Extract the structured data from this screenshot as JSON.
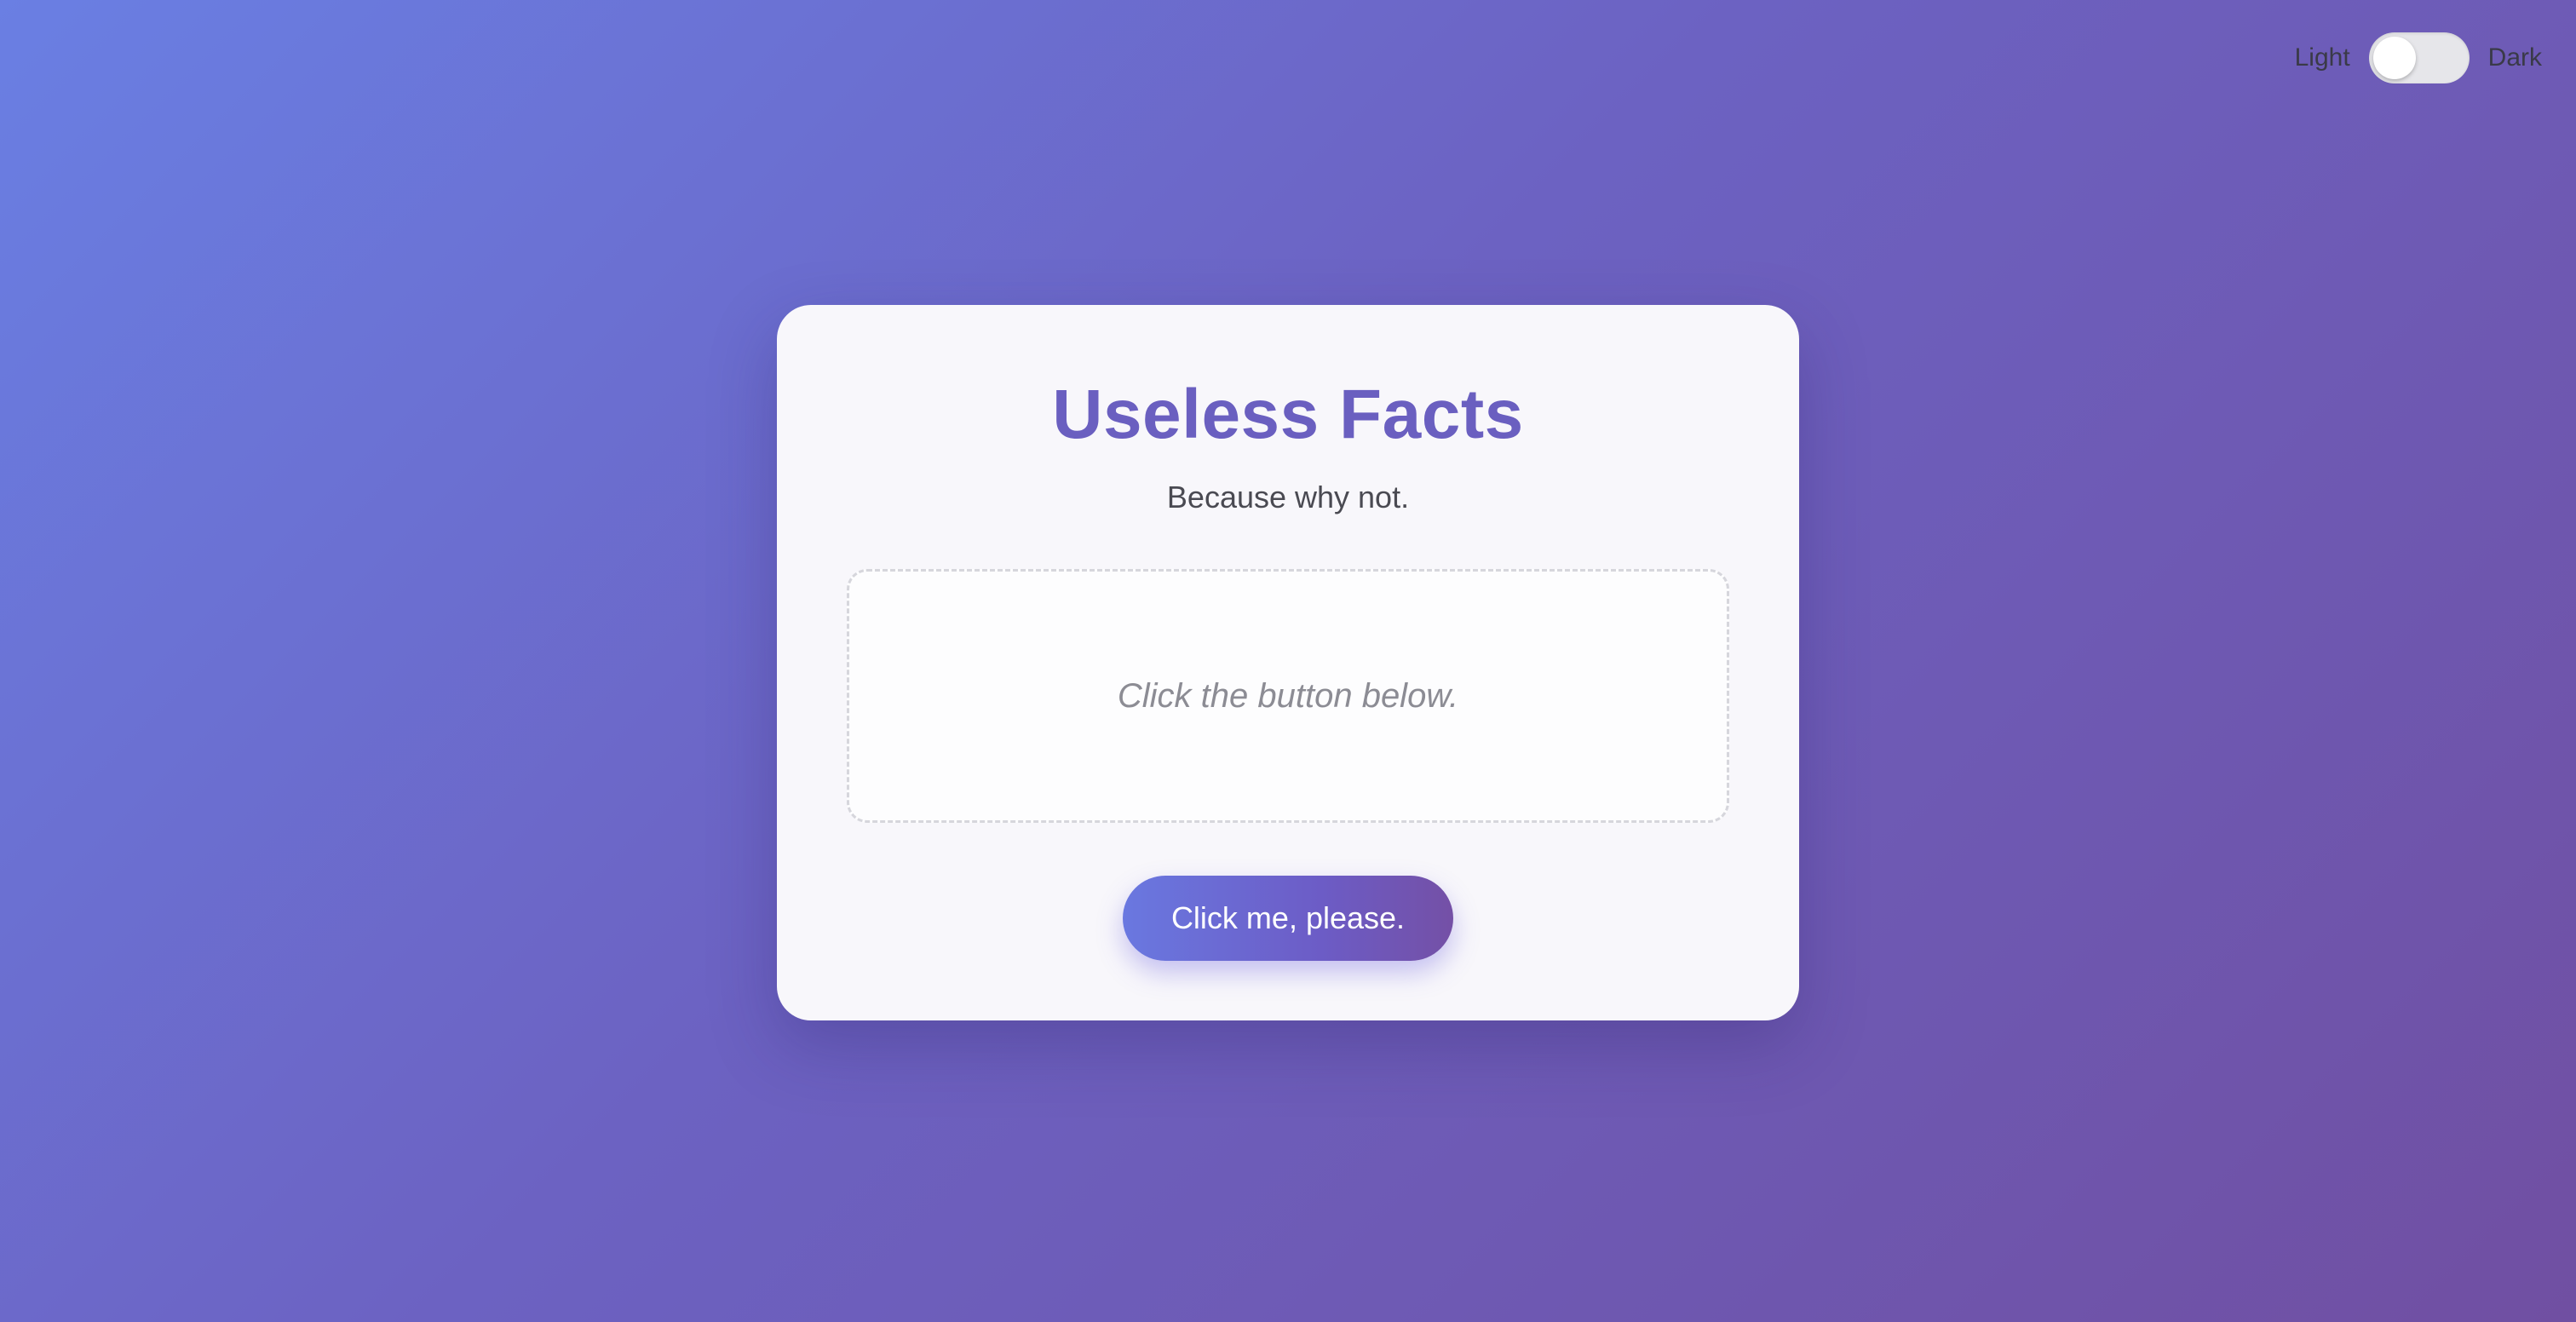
{
  "theme_toggle": {
    "light_label": "Light",
    "dark_label": "Dark",
    "state": "light"
  },
  "card": {
    "title": "Useless Facts",
    "subtitle": "Because why not.",
    "fact_placeholder": "Click the button below.",
    "button_label": "Click me, please."
  },
  "colors": {
    "background_start": "#6a7fe3",
    "background_end": "#704fa2",
    "title": "#6a5fc0",
    "card": "#f8f7fb"
  }
}
